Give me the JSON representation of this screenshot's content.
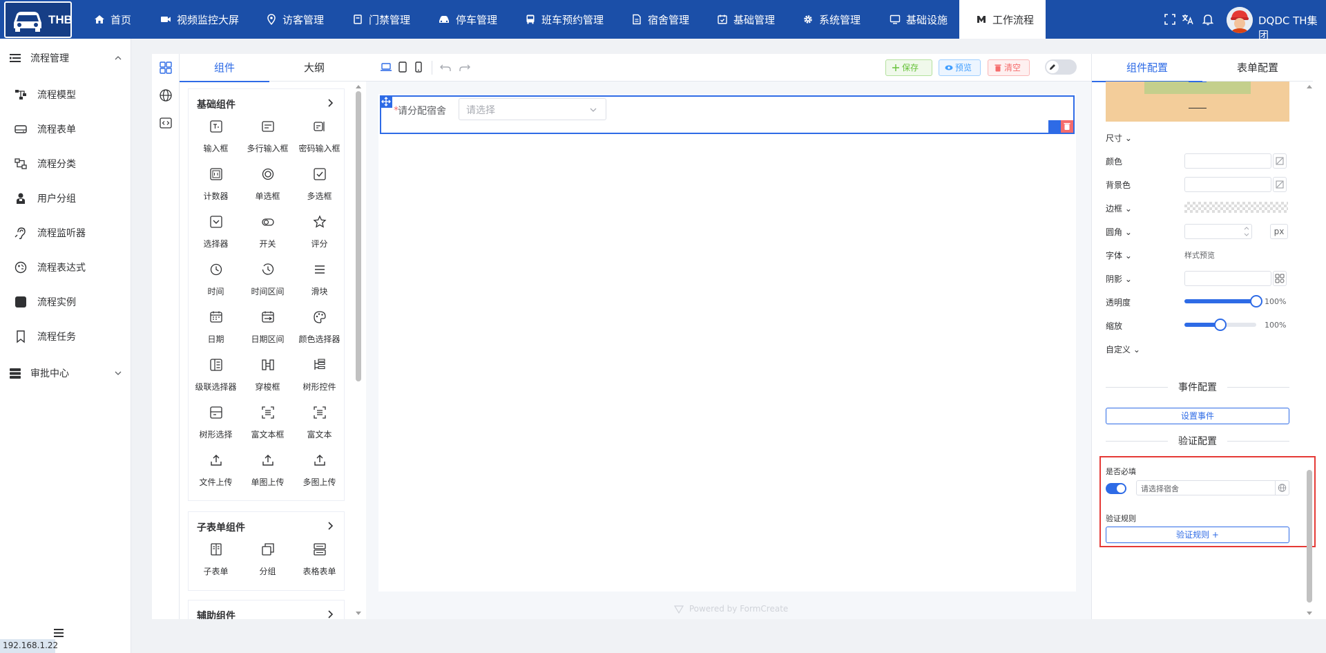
{
  "app": {
    "logo_text": "THB",
    "user_name": "DQDC TH集团"
  },
  "nav": [
    {
      "label": "首页",
      "icon": "home-icon"
    },
    {
      "label": "视频监控大屏",
      "icon": "video-icon"
    },
    {
      "label": "访客管理",
      "icon": "location-icon"
    },
    {
      "label": "门禁管理",
      "icon": "door-icon"
    },
    {
      "label": "停车管理",
      "icon": "car-icon"
    },
    {
      "label": "班车预约管理",
      "icon": "bus-icon"
    },
    {
      "label": "宿舍管理",
      "icon": "document-icon"
    },
    {
      "label": "基础管理",
      "icon": "calendar-check-icon"
    },
    {
      "label": "系统管理",
      "icon": "gear-icon"
    },
    {
      "label": "基础设施",
      "icon": "monitor-icon"
    },
    {
      "label": "工作流程",
      "icon": "workflow-icon"
    }
  ],
  "sidebar": {
    "group1": "流程管理",
    "items": [
      {
        "label": "流程模型",
        "icon": "model-icon"
      },
      {
        "label": "流程表单",
        "icon": "form-icon"
      },
      {
        "label": "流程分类",
        "icon": "category-icon"
      },
      {
        "label": "用户分组",
        "icon": "user-group-icon"
      },
      {
        "label": "流程监听器",
        "icon": "listener-icon"
      },
      {
        "label": "流程表达式",
        "icon": "expression-icon"
      },
      {
        "label": "流程实例",
        "icon": "instance-icon"
      },
      {
        "label": "流程任务",
        "icon": "bookmark-icon"
      }
    ],
    "group2": "审批中心",
    "ip": "192.168.1.22"
  },
  "components_panel": {
    "tabs": [
      "组件",
      "大纲"
    ],
    "sections": [
      {
        "title": "基础组件",
        "items": [
          "输入框",
          "多行输入框",
          "密码输入框",
          "计数器",
          "单选框",
          "多选框",
          "选择器",
          "开关",
          "评分",
          "时间",
          "时间区间",
          "滑块",
          "日期",
          "日期区间",
          "颜色选择器",
          "级联选择器",
          "穿梭框",
          "树形控件",
          "树形选择",
          "富文本框",
          "富文本",
          "文件上传",
          "单图上传",
          "多图上传"
        ]
      },
      {
        "title": "子表单组件",
        "items": [
          "子表单",
          "分组",
          "表格表单"
        ]
      },
      {
        "title": "辅助组件",
        "items": []
      }
    ]
  },
  "toolbar": {
    "save": "保存",
    "preview": "预览",
    "clear": "清空"
  },
  "canvas": {
    "field_label": "请分配宿舍",
    "field_placeholder": "请选择",
    "powered": "Powered by FormCreate"
  },
  "right_panel": {
    "tabs": [
      "组件配置",
      "表单配置"
    ],
    "props": {
      "size": "尺寸",
      "color": "颜色",
      "bg_color": "背景色",
      "border": "边框",
      "radius": "圆角",
      "radius_unit": "px",
      "font": "字体",
      "font_preview": "样式预览",
      "shadow": "阴影",
      "opacity": "透明度",
      "opacity_value": "100%",
      "opacity_level": 1.0,
      "scale": "缩放",
      "scale_value": "100%",
      "scale_level": 0.5,
      "custom": "自定义"
    },
    "event_section": "事件配置",
    "set_event": "设置事件",
    "validation_section": "验证配置",
    "required_label": "是否必填",
    "required_on": true,
    "required_message": "请选择宿舍",
    "rules_label": "验证规则",
    "rules_button": "验证规则 +"
  },
  "colors": {
    "topbar": "#1b4fa8",
    "accent": "#2e6be6",
    "highlight": "#e53935",
    "delete": "#f56c6c"
  }
}
